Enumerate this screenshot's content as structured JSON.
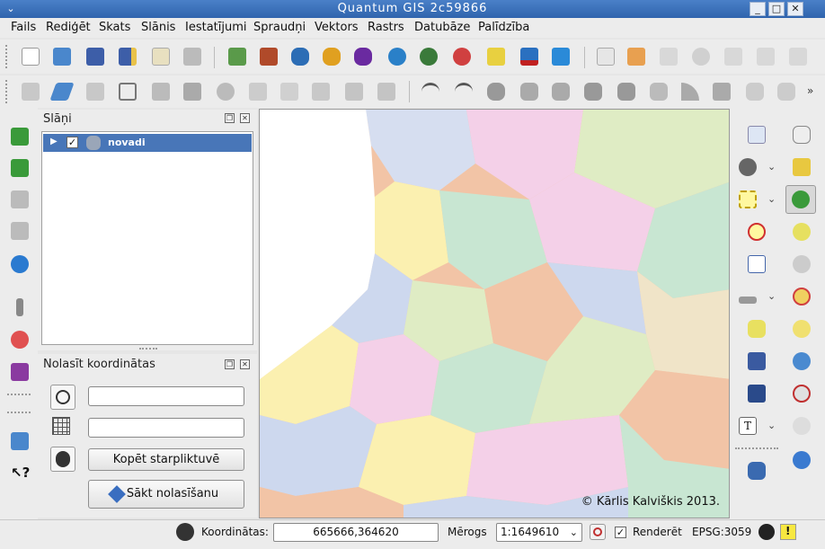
{
  "window": {
    "title": "Quantum GIS 2c59866",
    "minimize": "_",
    "maximize": "□",
    "close": "✕"
  },
  "menubar": [
    "Fails",
    "Rediģēt",
    "Skats",
    "Slānis",
    "Iestatījumi",
    "Spraudņi",
    "Vektors",
    "Rastrs",
    "Datubāze",
    "Palīdzība"
  ],
  "toolbar_row1_icons": [
    "new-project-icon",
    "open-project-icon",
    "save-project-icon",
    "save-as-icon",
    "print-composer-icon",
    "print-icon",
    "add-vector-layer-icon",
    "add-raster-layer-icon",
    "add-postgis-icon",
    "add-spatialite-icon",
    "add-mssql-icon",
    "add-wms-icon",
    "add-wcs-icon",
    "add-wfs-icon",
    "add-delimited-text-icon",
    "remove-layer-icon",
    "new-shapefile-icon",
    "spellcheck-icon",
    "plugin-tag-icon",
    "plugin-a-icon",
    "plugin-eye-icon",
    "plugin-b-icon",
    "plugin-c-icon",
    "plugin-d-icon"
  ],
  "toolbar_row2_icons": [
    "save-edits-icon",
    "toggle-editing-icon",
    "save-layer-icon",
    "add-feature-icon",
    "move-feature-icon",
    "node-tool-icon",
    "delete-selected-icon",
    "cut-features-icon",
    "copy-features-icon",
    "paste-features-icon",
    "toggle-topology-icon",
    "toggle-snapping-icon",
    "undo-icon",
    "redo-icon",
    "simplify-icon",
    "add-ring-icon",
    "add-part-icon",
    "delete-ring-icon",
    "delete-part-icon",
    "reshape-icon",
    "offset-curve-icon",
    "split-features-icon",
    "merge-features-icon",
    "merge-attributes-icon"
  ],
  "left_toolbar_icons": [
    "raster-histogram-icon",
    "raster-stretch-icon",
    "raster-local-icon",
    "raster-full-icon",
    "globe-icon",
    "measure-icon",
    "add-tag-icon",
    "georeferencer-icon",
    "blank",
    "help-book-icon",
    "whats-this-icon"
  ],
  "layers_panel": {
    "title": "Slāņi",
    "layers": [
      {
        "name": "novadi",
        "checked": "✓"
      }
    ]
  },
  "coord_panel": {
    "title": "Nolasīt koordinātas",
    "copy_button": "Kopēt starpliktuvē",
    "start_button": "Sākt nolasīšanu"
  },
  "map": {
    "copyright": "© Kārlis Kalviškis 2013."
  },
  "right_toolbar_icons": [
    "identify-icon",
    "pan-icon",
    "settings-icon",
    "pan-to-selection-icon",
    "select-icon",
    "zoom-in-icon",
    "deselect-icon",
    "zoom-out-icon",
    "attribute-table-icon",
    "zoom-full-icon",
    "measure-line-icon",
    "zoom-to-selection-icon",
    "annotation-icon",
    "zoom-to-layer-icon",
    "map-tips-icon",
    "zoom-native-icon",
    "new-bookmark-icon",
    "zoom-last-icon",
    "show-bookmarks-icon",
    "zoom-next-icon",
    "text-annotation-icon",
    "refresh-icon",
    "database-icon"
  ],
  "statusbar": {
    "coord_label": "Koordinātas:",
    "coord_value": "665666,364620",
    "scale_label": "Mērogs",
    "scale_value": "1:1649610",
    "render_label": "Renderēt",
    "render_checked": "✓",
    "crs": "EPSG:3059"
  }
}
